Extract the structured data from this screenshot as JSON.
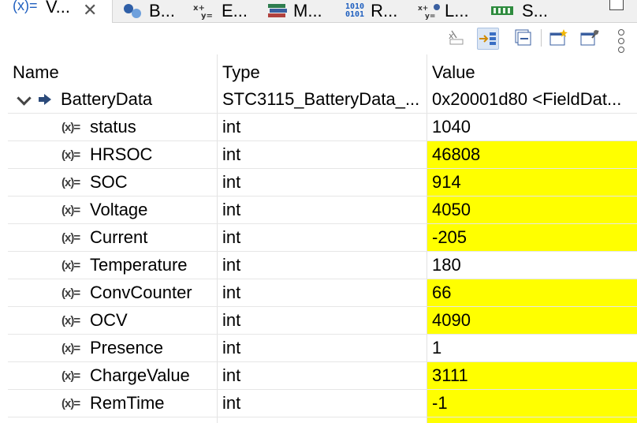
{
  "tabs": [
    {
      "label": "V...",
      "icon": "variables-icon",
      "active": true
    },
    {
      "label": "B...",
      "icon": "breakpoints-icon"
    },
    {
      "label": "E...",
      "icon": "expressions-icon"
    },
    {
      "label": "M...",
      "icon": "modules-icon"
    },
    {
      "label": "R...",
      "icon": "registers-icon"
    },
    {
      "label": "L...",
      "icon": "live-expressions-icon"
    },
    {
      "label": "S...",
      "icon": "sfrs-icon"
    }
  ],
  "tab_icon_text": {
    "variables": "(x)=",
    "registers_top": "1010",
    "registers_bottom": "0101"
  },
  "toolbar": {
    "buttons": [
      {
        "icon": "remove-all-icon"
      },
      {
        "icon": "show-type-names-icon",
        "pressed": true
      },
      {
        "icon": "collapse-all-icon"
      },
      {
        "icon": "new-window-icon"
      },
      {
        "icon": "pin-icon"
      }
    ]
  },
  "columns": {
    "name": "Name",
    "type": "Type",
    "value": "Value"
  },
  "parent": {
    "name": "BatteryData",
    "type": "STC3115_BatteryData_...",
    "value": "0x20001d80 <FieldDat..."
  },
  "var_icon_text": "(x)=",
  "rows": [
    {
      "name": "status",
      "type": "int",
      "value": "1040",
      "changed": false
    },
    {
      "name": "HRSOC",
      "type": "int",
      "value": "46808",
      "changed": true
    },
    {
      "name": "SOC",
      "type": "int",
      "value": "914",
      "changed": true
    },
    {
      "name": "Voltage",
      "type": "int",
      "value": "4050",
      "changed": true
    },
    {
      "name": "Current",
      "type": "int",
      "value": "-205",
      "changed": true
    },
    {
      "name": "Temperature",
      "type": "int",
      "value": "180",
      "changed": false
    },
    {
      "name": "ConvCounter",
      "type": "int",
      "value": "66",
      "changed": true
    },
    {
      "name": "OCV",
      "type": "int",
      "value": "4090",
      "changed": true
    },
    {
      "name": "Presence",
      "type": "int",
      "value": "1",
      "changed": false
    },
    {
      "name": "ChargeValue",
      "type": "int",
      "value": "3111",
      "changed": true
    },
    {
      "name": "RemTime",
      "type": "int",
      "value": "-1",
      "changed": true
    }
  ],
  "colors": {
    "changed_highlight": "#ffff00",
    "selection": "#dbe6f4",
    "accent": "#1f5fbf"
  }
}
